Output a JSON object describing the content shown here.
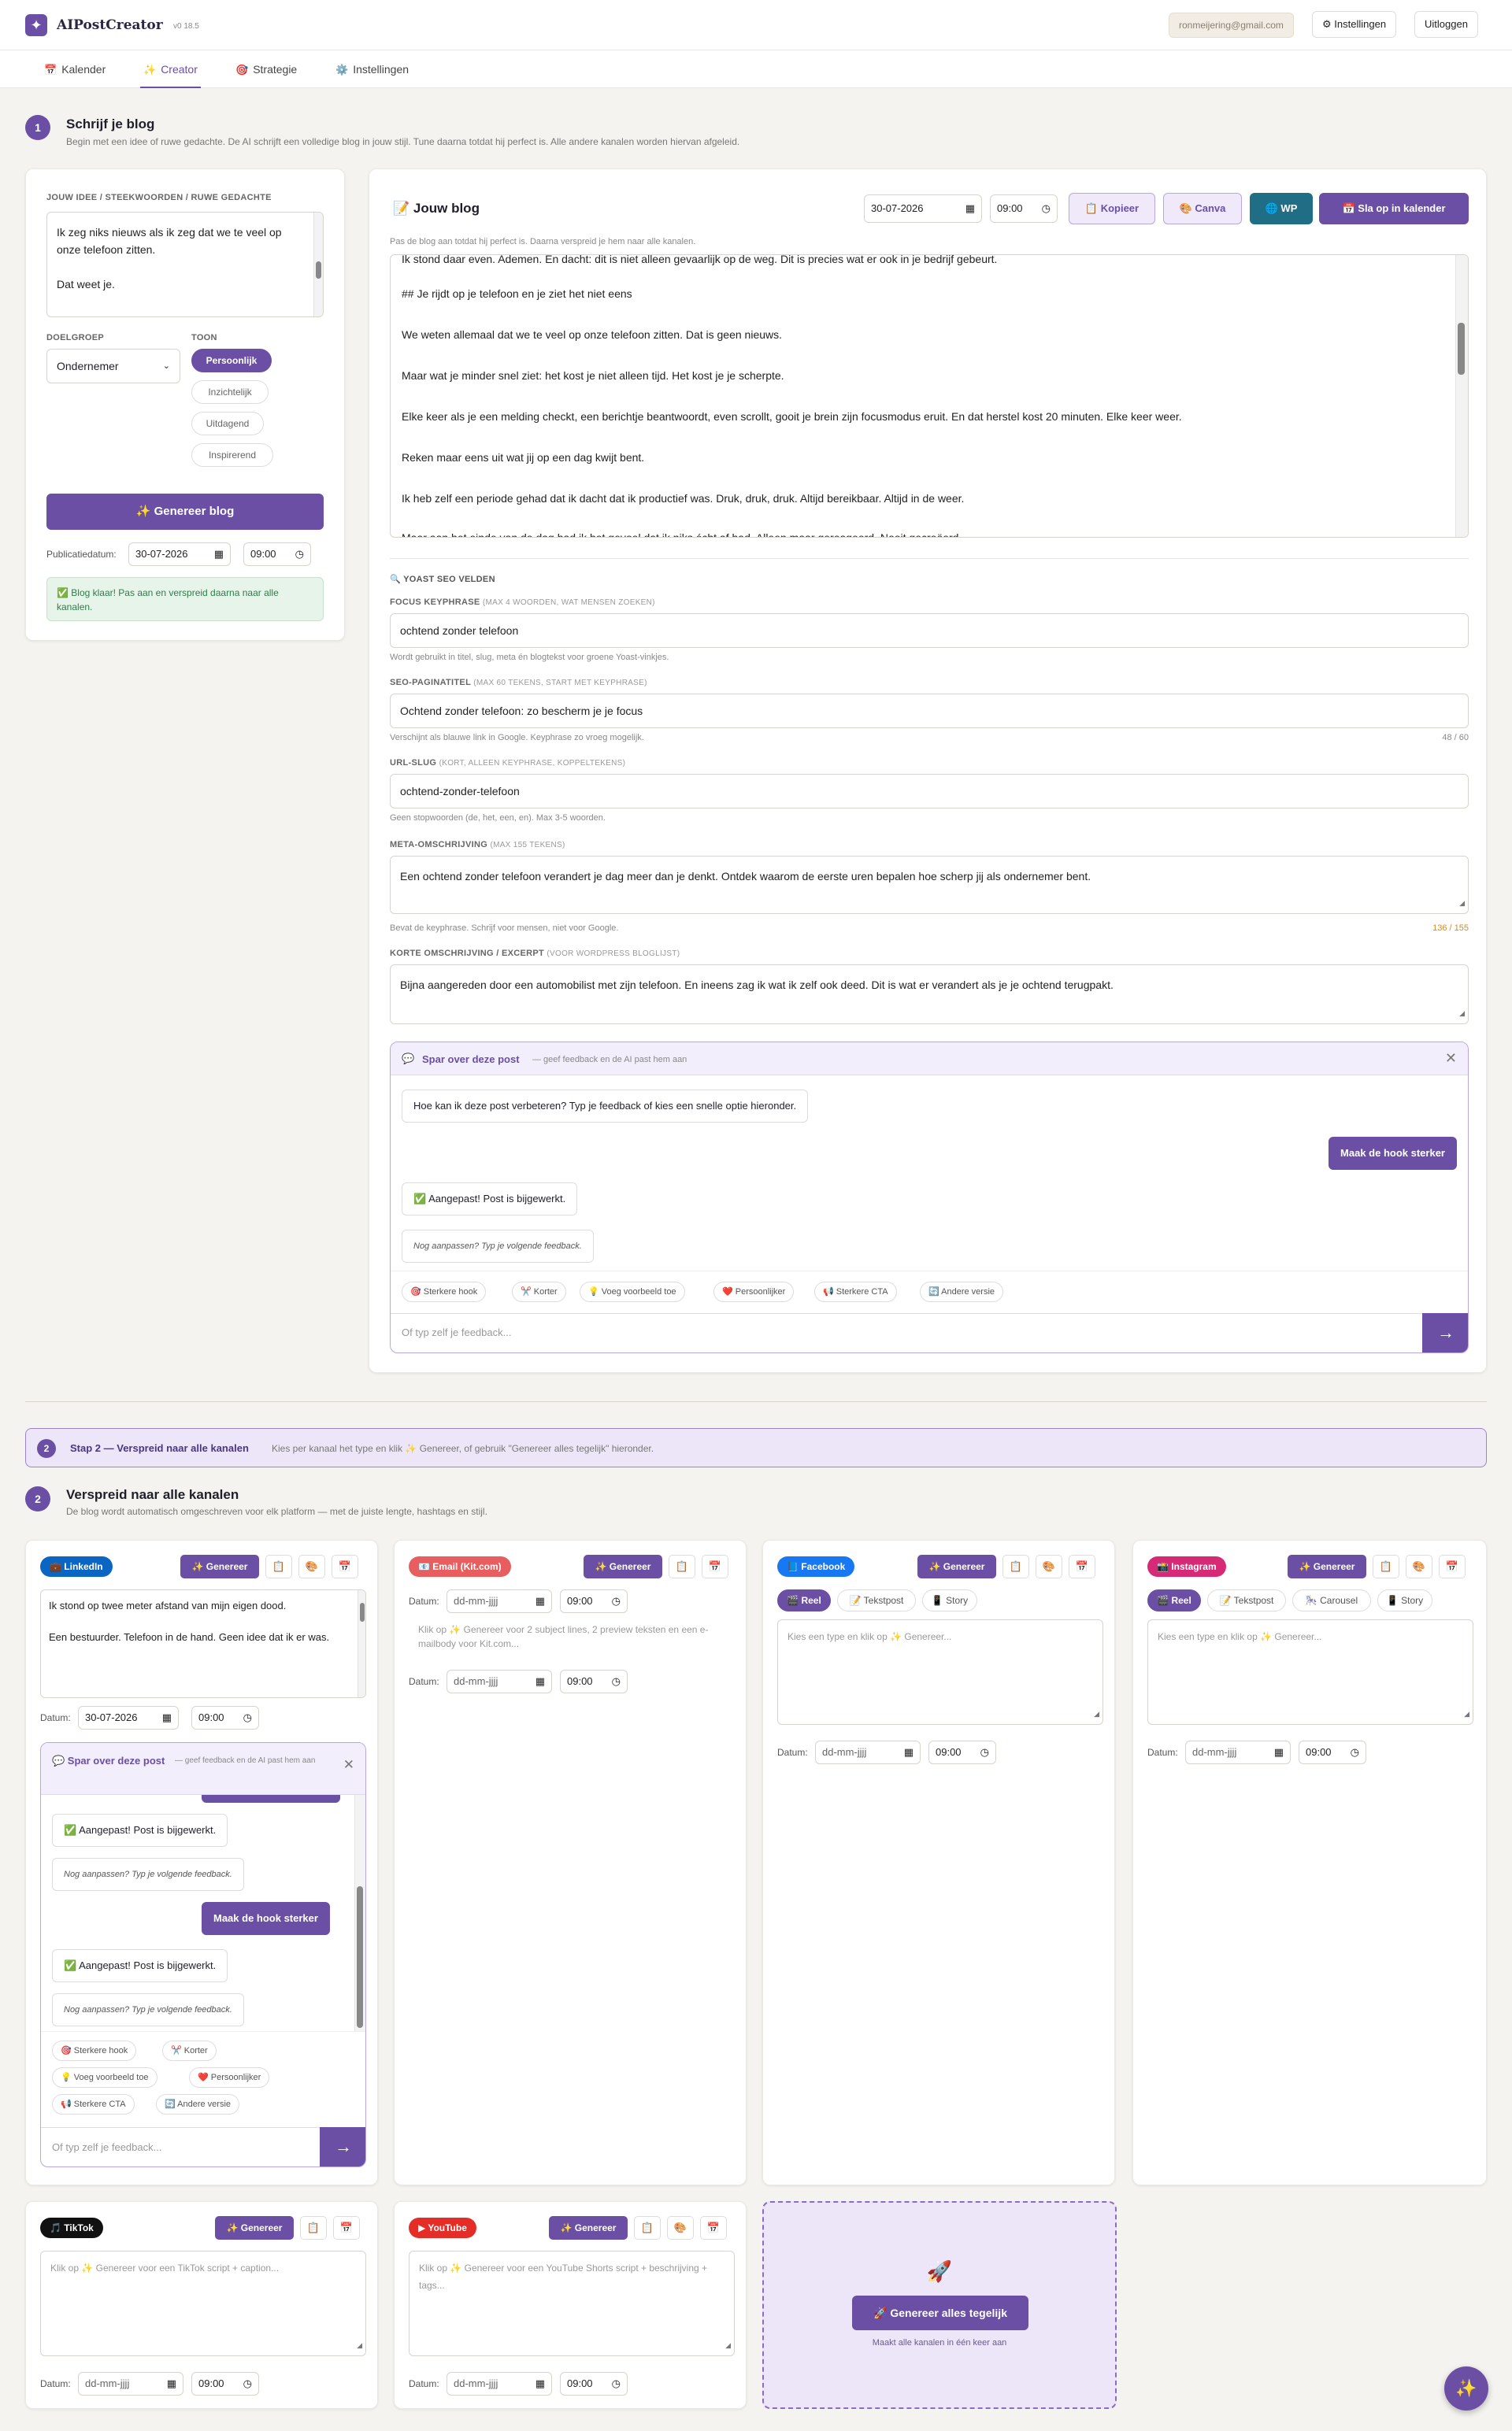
{
  "header": {
    "app_name": "AIPostCreator",
    "version": "v0 18.5",
    "email": "ronmeijering@gmail.com",
    "settings_label": "Instellingen",
    "logout_label": "Uitloggen"
  },
  "nav": {
    "tabs": [
      {
        "label": "Kalender",
        "icon": "📅"
      },
      {
        "label": "Creator",
        "icon": "✨"
      },
      {
        "label": "Strategie",
        "icon": "🎯"
      },
      {
        "label": "Instellingen",
        "icon": "⚙️"
      }
    ]
  },
  "step1": {
    "num": "1",
    "title": "Schrijf je blog",
    "subtitle": "Begin met een idee of ruwe gedachte. De AI schrijft een volledige blog in jouw stijl. Tune daarna totdat hij perfect is. Alle andere kanalen worden hiervan afgeleid."
  },
  "idea_panel": {
    "label": "Jouw idee / steekwoorden / ruwe gedachte",
    "idea_line1": "Ik zeg niks nieuws als ik zeg dat we te veel op onze telefoon zitten.",
    "idea_line2": "Dat weet je.",
    "audience_label": "Doelgroep",
    "audience_value": "Ondernemer",
    "tone_label": "Toon",
    "tones": [
      "Persoonlijk",
      "Inzichtelijk",
      "Uitdagend",
      "Inspirerend"
    ],
    "generate_label": "✨ Genereer blog",
    "pubdate_label": "Publicatiedatum:",
    "date": "30-07-2026",
    "time": "09:00",
    "success": "✅ Blog klaar! Pas aan en verspreid daarna naar alle kanalen."
  },
  "blog": {
    "icon": "📝",
    "title": "Jouw blog",
    "date": "30-07-2026",
    "time": "09:00",
    "copy_label": "📋 Kopieer",
    "canva_label": "🎨 Canva",
    "wp_label": "🌐 WP",
    "save_label": "📅 Sla op in kalender",
    "hint": "Pas de blog aan totdat hij perfect is. Daarna verspreid je hem naar alle kanalen.",
    "lines": [
      "Ik stond daar even. Ademen. En dacht: dit is niet alleen gevaarlijk op de weg. Dit is precies wat er ook in je bedrijf gebeurt.",
      "## Je rijdt op je telefoon en je ziet het niet eens",
      "We weten allemaal dat we te veel op onze telefoon zitten. Dat is geen nieuws.",
      "Maar wat je minder snel ziet: het kost je niet alleen tijd. Het kost je je scherpte.",
      "Elke keer als je een melding checkt, een berichtje beantwoordt, even scrollt, gooit je brein zijn focusmodus eruit. En dat herstel kost 20 minuten. Elke keer weer.",
      "Reken maar eens uit wat jij op een dag kwijt bent.",
      "Ik heb zelf een periode gehad dat ik dacht dat ik productief was. Druk, druk, druk. Altijd bereikbaar. Altijd in de weer.",
      "Maar aan het einde van de dag had ik het gevoel dat ik niks écht af had. Alleen maar gereageerd. Nooit gecreëerd."
    ]
  },
  "seo": {
    "heading": "🔍 Yoast SEO velden",
    "keyphrase_label": "Focus keyphrase",
    "keyphrase_note": "(max 4 woorden, wat mensen zoeken)",
    "keyphrase": "ochtend zonder telefoon",
    "keyphrase_hint": "Wordt gebruikt in titel, slug, meta én blogtekst voor groene Yoast-vinkjes.",
    "title_label": "SEO-paginatitel",
    "title_note": "(max 60 tekens, start met keyphrase)",
    "title": "Ochtend zonder telefoon: zo bescherm je je focus",
    "title_hint": "Verschijnt als blauwe link in Google. Keyphrase zo vroeg mogelijk.",
    "title_count": "48 / 60",
    "slug_label": "URL-slug",
    "slug_note": "(kort, alleen keyphrase, koppeltekens)",
    "slug": "ochtend-zonder-telefoon",
    "slug_hint": "Geen stopwoorden (de, het, een, en). Max 3-5 woorden.",
    "meta_label": "Meta-omschrijving",
    "meta_note": "(max 155 tekens)",
    "meta": "Een ochtend zonder telefoon verandert je dag meer dan je denkt. Ontdek waarom de eerste uren bepalen hoe scherp jij als ondernemer bent.",
    "meta_hint": "Bevat de keyphrase. Schrijf voor mensen, niet voor Google.",
    "meta_count": "136 / 155",
    "excerpt_label": "Korte omschrijving / excerpt",
    "excerpt_note": "(voor WordPress bloglijst)",
    "excerpt": "Bijna aangereden door een automobilist met zijn telefoon. En ineens zag ik wat ik zelf ook deed. Dit is wat er verandert als je je ochtend terugpakt."
  },
  "chat": {
    "icon": "💬",
    "title": "Spar over deze post",
    "subtitle": "— geef feedback en de AI past hem aan",
    "intro": "Hoe kan ik deze post verbeteren? Typ je feedback of kies een snelle optie hieronder.",
    "user_msg": "Maak de hook sterker",
    "done": "✅ Aangepast! Post is bijgewerkt.",
    "more": "Nog aanpassen? Typ je volgende feedback.",
    "chips": [
      "🎯 Sterkere hook",
      "✂️ Korter",
      "💡 Voeg voorbeeld toe",
      "❤️ Persoonlijker",
      "📢 Sterkere CTA",
      "🔄 Andere versie"
    ],
    "placeholder": "Of typ zelf je feedback...",
    "send": "→"
  },
  "step2_banner": {
    "num": "2",
    "title": "Stap 2 — Verspreid naar alle kanalen",
    "text": "Kies per kanaal het type en klik ✨ Genereer, of gebruik \"Genereer alles tegelijk\" hieronder."
  },
  "step2": {
    "num": "2",
    "title": "Verspreid naar alle kanalen",
    "subtitle": "De blog wordt automatisch omgeschreven voor elk platform — met de juiste lengte, hashtags en stijl."
  },
  "channels": {
    "generate": "✨ Genereer",
    "date_label": "Datum:",
    "date_empty": "dd-mm-jjjj",
    "time": "09:00",
    "linkedin": {
      "name": "💼 LinkedIn",
      "color": "#0a66c2",
      "date": "30-07-2026",
      "line1": "Ik stond op twee meter afstand van mijn eigen dood.",
      "line2": "Een bestuurder. Telefoon in de hand. Geen idee dat ik er was."
    },
    "email": {
      "name": "📧 Email (Kit.com)",
      "color": "#e85d5d",
      "placeholder": "Klik op ✨ Genereer voor 2 subject lines, 2 preview teksten en een e-mailbody voor Kit.com..."
    },
    "facebook": {
      "name": "📘 Facebook",
      "color": "#1877f2",
      "types": [
        "🎬 Reel",
        "📝 Tekstpost",
        "📱 Story"
      ],
      "placeholder": "Kies een type en klik op ✨ Genereer..."
    },
    "instagram": {
      "name": "📸 Instagram",
      "color": "#d62976",
      "types": [
        "🎬 Reel",
        "📝 Tekstpost",
        "🎠 Carousel",
        "📱 Story"
      ],
      "placeholder": "Kies een type en klik op ✨ Genereer..."
    },
    "tiktok": {
      "name": "🎵 TikTok",
      "color": "#111111",
      "placeholder": "Klik op ✨ Genereer voor een TikTok script + caption..."
    },
    "youtube": {
      "name": "▶ YouTube",
      "color": "#e52d27",
      "placeholder": "Klik op ✨ Genereer voor een YouTube Shorts script + beschrijving + tags..."
    }
  },
  "linkedin_chat": {
    "title": "💬 Spar over deze post",
    "subtitle": "— geef feedback en de AI past hem aan",
    "done": "✅ Aangepast! Post is bijgewerkt.",
    "more": "Nog aanpassen? Typ je volgende feedback.",
    "user_msg": "Maak de hook sterker",
    "chips": [
      "🎯 Sterkere hook",
      "✂️ Korter",
      "💡 Voeg voorbeeld toe",
      "❤️ Persoonlijker",
      "📢 Sterkere CTA",
      "🔄 Andere versie"
    ],
    "placeholder": "Of typ zelf je feedback...",
    "send": "→"
  },
  "generate_all": {
    "icon": "🚀",
    "label": "🚀 Genereer alles tegelijk",
    "sub": "Maakt alle kanalen in één keer aan"
  },
  "fab_icon": "✨"
}
